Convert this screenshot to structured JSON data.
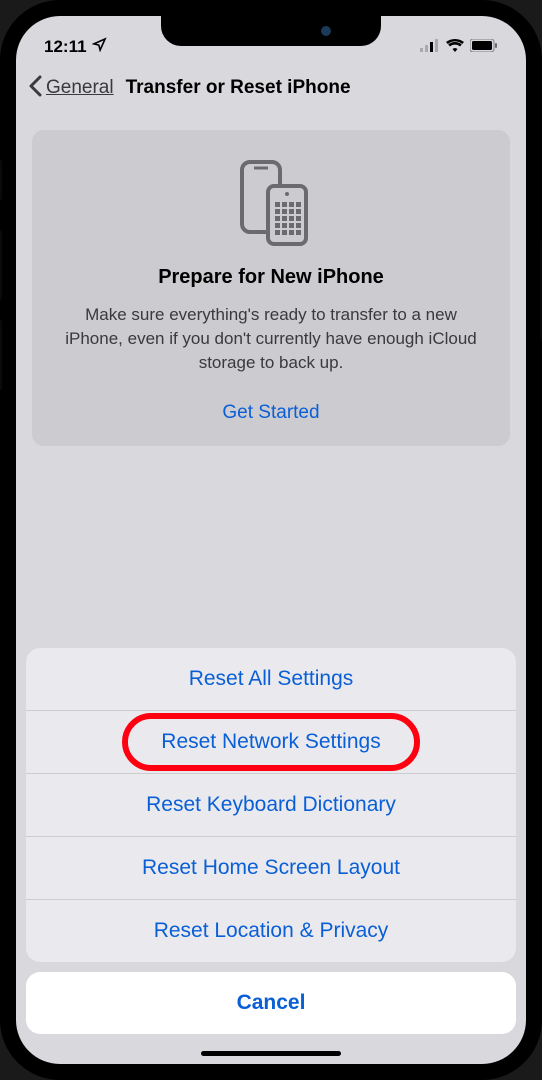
{
  "status_bar": {
    "time": "12:11",
    "location_icon": "location-arrow",
    "signal_icon": "cellular-signal",
    "wifi_icon": "wifi",
    "battery_icon": "battery"
  },
  "nav": {
    "back_label": "General",
    "title": "Transfer or Reset iPhone"
  },
  "promo": {
    "title": "Prepare for New iPhone",
    "description": "Make sure everything's ready to transfer to a new iPhone, even if you don't currently have enough iCloud storage to back up.",
    "link": "Get Started"
  },
  "action_sheet": {
    "items": [
      "Reset All Settings",
      "Reset Network Settings",
      "Reset Keyboard Dictionary",
      "Reset Home Screen Layout",
      "Reset Location & Privacy"
    ],
    "highlighted_index": 1,
    "cancel": "Cancel"
  }
}
